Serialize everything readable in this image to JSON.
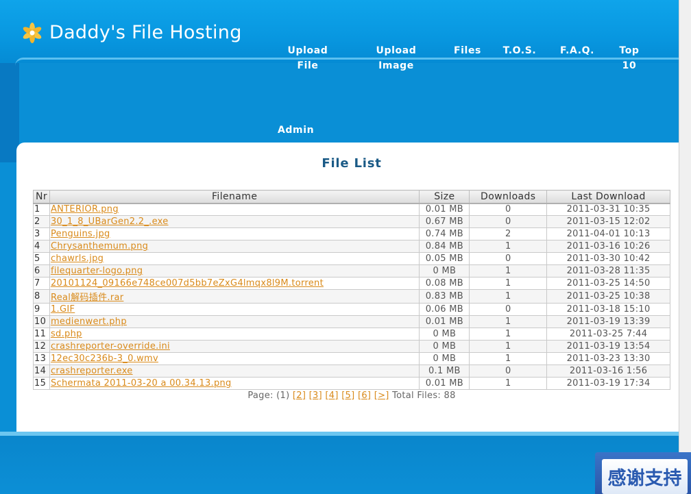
{
  "header": {
    "title": "Daddy's File Hosting",
    "logo_icon": "flower-icon"
  },
  "nav": {
    "upload_file": "Upload File",
    "upload_image": "Upload Image",
    "files": "Files",
    "tos": "T.O.S.",
    "faq": "F.A.Q.",
    "top10_line1": "Top",
    "top10_line2": "10",
    "admin": "Admin"
  },
  "main": {
    "heading": "File List",
    "columns": [
      "Nr",
      "Filename",
      "Size",
      "Downloads",
      "Last Download"
    ],
    "rows": [
      {
        "nr": "1",
        "name": "ANTERIOR.png",
        "size": "0.01 MB",
        "downloads": "0",
        "last": "2011-03-31 10:35"
      },
      {
        "nr": "2",
        "name": "30_1_8_UBarGen2.2_.exe",
        "size": "0.67 MB",
        "downloads": "0",
        "last": "2011-03-15 12:02"
      },
      {
        "nr": "3",
        "name": "Penguins.jpg",
        "size": "0.74 MB",
        "downloads": "2",
        "last": "2011-04-01 10:13"
      },
      {
        "nr": "4",
        "name": "Chrysanthemum.png",
        "size": "0.84 MB",
        "downloads": "1",
        "last": "2011-03-16 10:26"
      },
      {
        "nr": "5",
        "name": "chawrls.jpg",
        "size": "0.05 MB",
        "downloads": "0",
        "last": "2011-03-30 10:42"
      },
      {
        "nr": "6",
        "name": "filequarter-logo.png",
        "size": "0 MB",
        "downloads": "1",
        "last": "2011-03-28 11:35"
      },
      {
        "nr": "7",
        "name": "20101124_09166e748ce007d5bb7eZxG4lmqx8l9M.torrent",
        "size": "0.08 MB",
        "downloads": "1",
        "last": "2011-03-25 14:50"
      },
      {
        "nr": "8",
        "name": "Real解码插件.rar",
        "size": "0.83 MB",
        "downloads": "1",
        "last": "2011-03-25 10:38"
      },
      {
        "nr": "9",
        "name": "1.GIF",
        "size": "0.06 MB",
        "downloads": "0",
        "last": "2011-03-18 15:10"
      },
      {
        "nr": "10",
        "name": "medienwert.php",
        "size": "0.01 MB",
        "downloads": "1",
        "last": "2011-03-19 13:39"
      },
      {
        "nr": "11",
        "name": "sd.php",
        "size": "0 MB",
        "downloads": "1",
        "last": "2011-03-25 7:44"
      },
      {
        "nr": "12",
        "name": "crashreporter-override.ini",
        "size": "0 MB",
        "downloads": "1",
        "last": "2011-03-19 13:54"
      },
      {
        "nr": "13",
        "name": "12ec30c236b-3_0.wmv",
        "size": "0 MB",
        "downloads": "1",
        "last": "2011-03-23 13:30"
      },
      {
        "nr": "14",
        "name": "crashreporter.exe",
        "size": "0.1 MB",
        "downloads": "0",
        "last": "2011-03-16 1:56"
      },
      {
        "nr": "15",
        "name": "Schermata 2011-03-20 a 00.34.13.png",
        "size": "0.01 MB",
        "downloads": "1",
        "last": "2011-03-19 17:34"
      }
    ]
  },
  "pager": {
    "label": "Page:",
    "current": "(1)",
    "pages": [
      "[2]",
      "[3]",
      "[4]",
      "[5]",
      "[6]"
    ],
    "next": "[>]",
    "total": "Total Files: 88"
  },
  "badge": {
    "text": "感谢支持"
  }
}
